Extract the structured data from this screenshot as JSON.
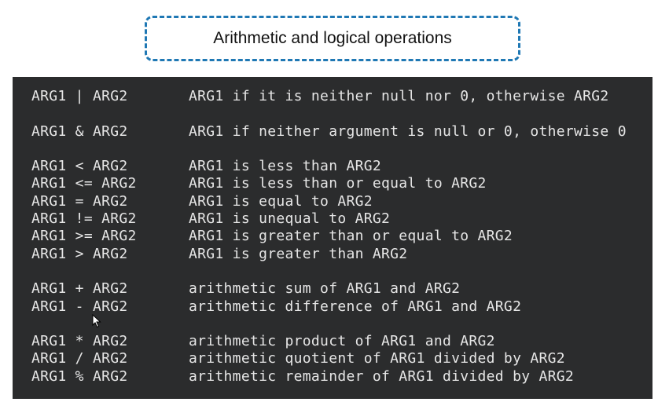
{
  "title": "Arithmetic and logical operations",
  "accent_color": "#1f78b4",
  "terminal_bg": "#2b2c2d",
  "operations": [
    {
      "op": "ARG1 | ARG2",
      "desc": "ARG1 if it is neither null nor 0, otherwise ARG2",
      "gap": false
    },
    {
      "op": "ARG1 & ARG2",
      "desc": "ARG1 if neither argument is null or 0, otherwise 0",
      "gap": true
    },
    {
      "op": "ARG1 < ARG2",
      "desc": "ARG1 is less than ARG2",
      "gap": true
    },
    {
      "op": "ARG1 <= ARG2",
      "desc": "ARG1 is less than or equal to ARG2",
      "gap": false
    },
    {
      "op": "ARG1 = ARG2",
      "desc": "ARG1 is equal to ARG2",
      "gap": false
    },
    {
      "op": "ARG1 != ARG2",
      "desc": "ARG1 is unequal to ARG2",
      "gap": false
    },
    {
      "op": "ARG1 >= ARG2",
      "desc": "ARG1 is greater than or equal to ARG2",
      "gap": false
    },
    {
      "op": "ARG1 > ARG2",
      "desc": "ARG1 is greater than ARG2",
      "gap": false
    },
    {
      "op": "ARG1 + ARG2",
      "desc": "arithmetic sum of ARG1 and ARG2",
      "gap": true
    },
    {
      "op": "ARG1 - ARG2",
      "desc": "arithmetic difference of ARG1 and ARG2",
      "gap": false
    },
    {
      "op": "ARG1 * ARG2",
      "desc": "arithmetic product of ARG1 and ARG2",
      "gap": true
    },
    {
      "op": "ARG1 / ARG2",
      "desc": "arithmetic quotient of ARG1 divided by ARG2",
      "gap": false
    },
    {
      "op": "ARG1 % ARG2",
      "desc": "arithmetic remainder of ARG1 divided by ARG2",
      "gap": false
    }
  ]
}
